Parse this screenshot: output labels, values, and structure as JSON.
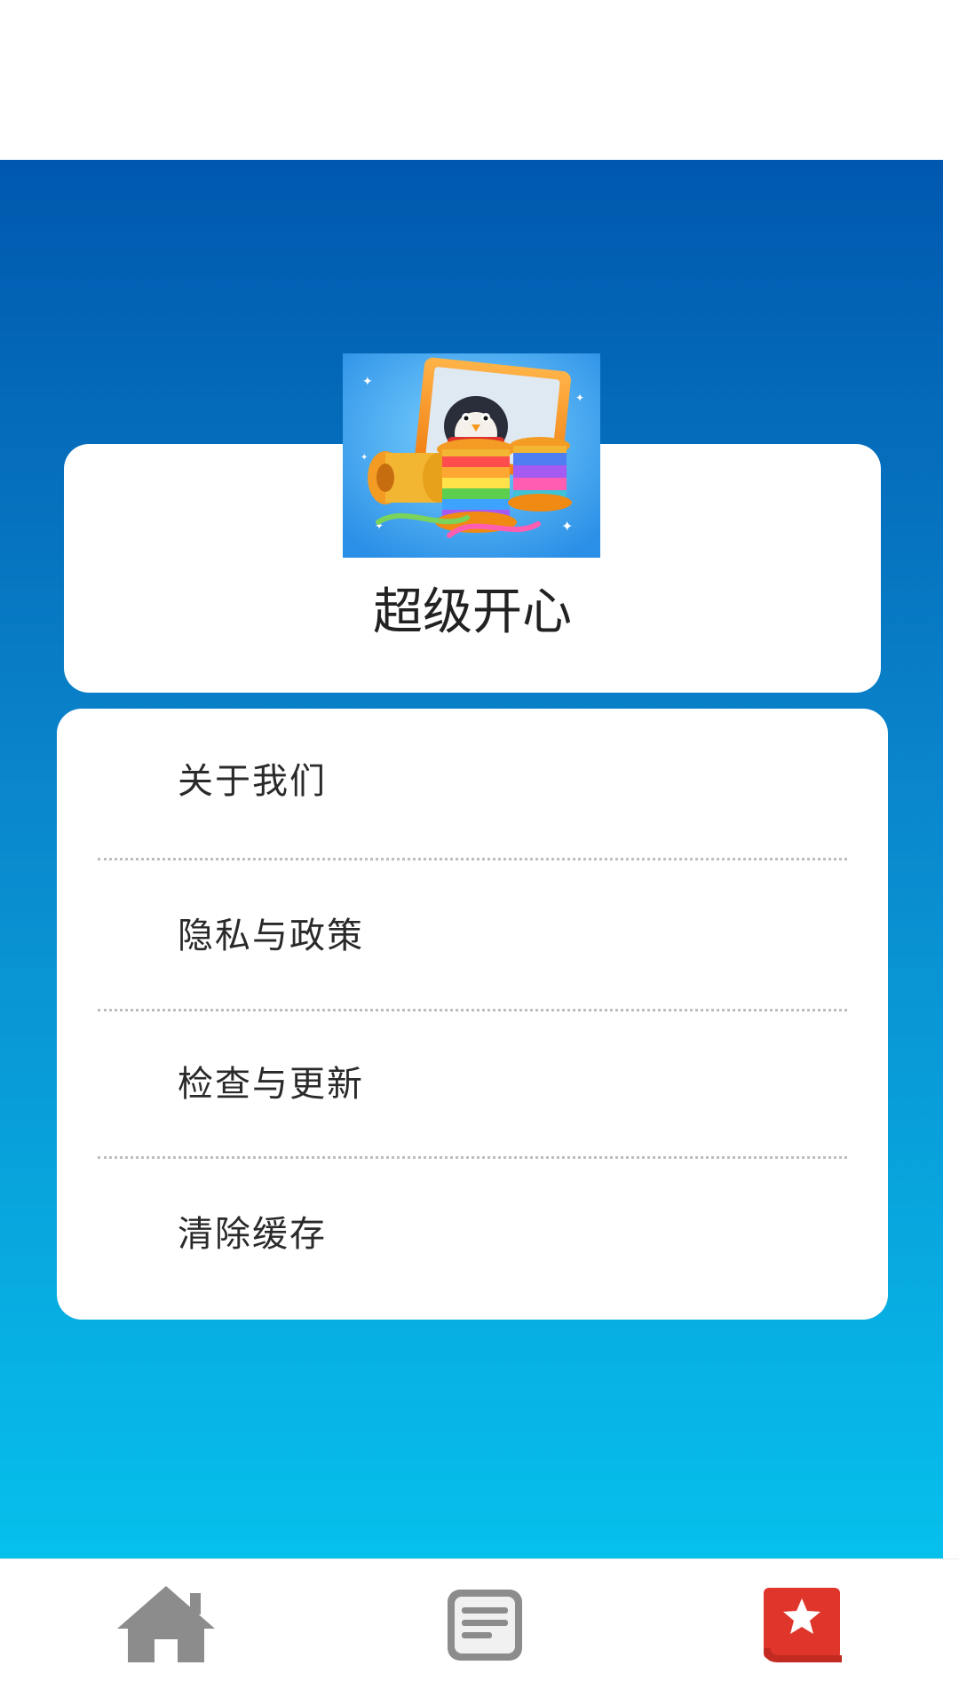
{
  "app": {
    "name": "超级开心"
  },
  "menu": {
    "items": [
      {
        "label": "关于我们"
      },
      {
        "label": "隐私与政策"
      },
      {
        "label": "检查与更新"
      },
      {
        "label": "清除缓存"
      }
    ]
  },
  "bottom_nav": {
    "items": [
      {
        "icon": "home-icon",
        "active": false
      },
      {
        "icon": "list-icon",
        "active": false
      },
      {
        "icon": "favorites-book-icon",
        "active": true
      }
    ]
  },
  "colors": {
    "gradient_top": "#0058ae",
    "gradient_bottom": "#06c0ec",
    "inactive_icon": "#8c8c8c",
    "active_icon": "#e0352b"
  }
}
